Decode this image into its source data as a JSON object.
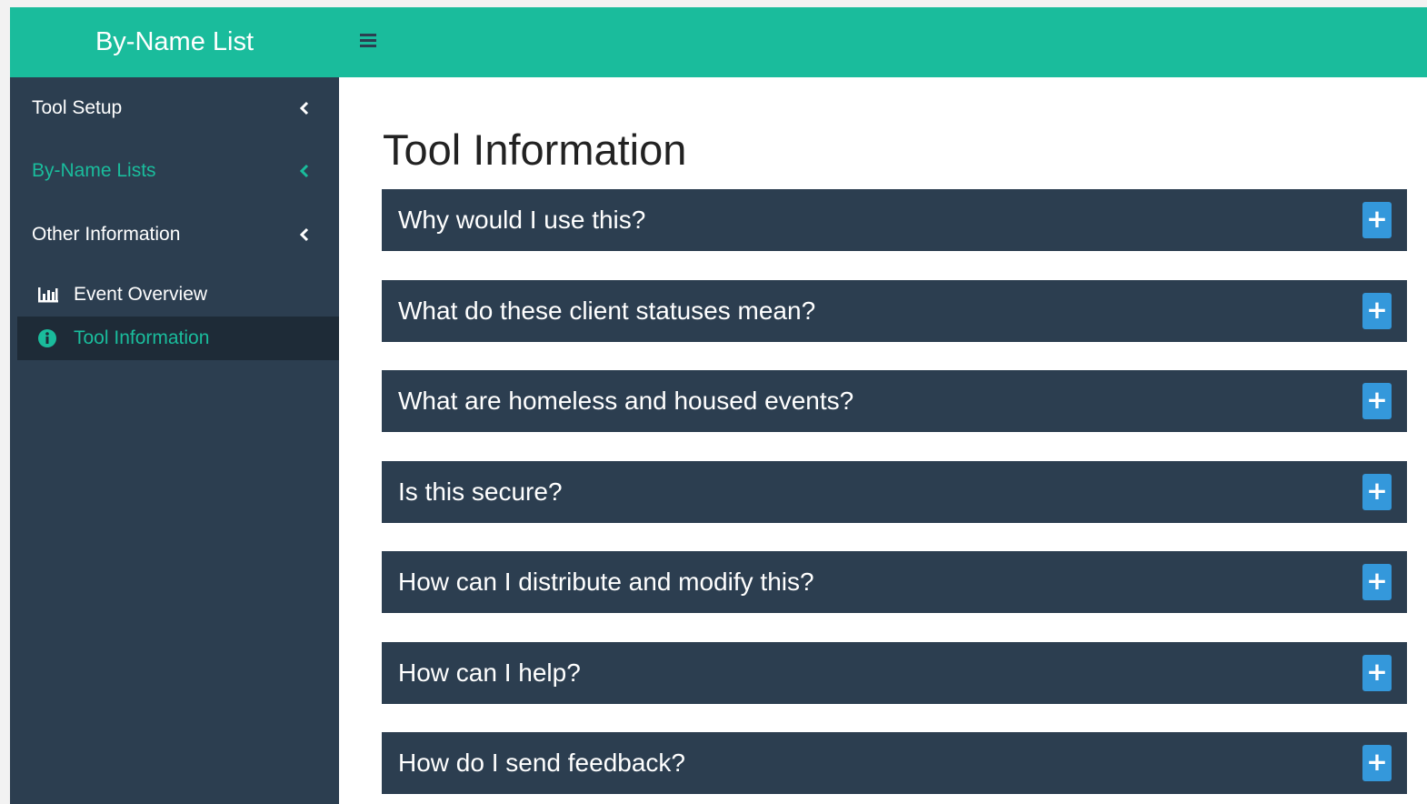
{
  "header": {
    "brand": "By-Name List"
  },
  "sidebar": {
    "items": [
      {
        "label": "Tool Setup"
      },
      {
        "label": "By-Name Lists"
      },
      {
        "label": "Other Information"
      }
    ],
    "subitems": [
      {
        "label": "Event Overview",
        "icon": "bar-chart-icon"
      },
      {
        "label": "Tool Information",
        "icon": "info-circle-icon"
      }
    ],
    "active_group": "By-Name Lists",
    "selected_item": "Tool Information"
  },
  "main": {
    "title": "Tool Information",
    "panels": [
      {
        "question": "Why would I use this?",
        "button": "+"
      },
      {
        "question": "What do these client statuses mean?",
        "button": "+"
      },
      {
        "question": "What are homeless and housed events?",
        "button": "+"
      },
      {
        "question": "Is this secure?",
        "button": "+"
      },
      {
        "question": "How can I distribute and modify this?",
        "button": "+"
      },
      {
        "question": "How can I help?",
        "button": "+"
      },
      {
        "question": "How do I send feedback?",
        "button": "+"
      }
    ]
  },
  "colors": {
    "header": "#1abc9c",
    "sidebar": "#2c3e50",
    "accent": "#1abc9c",
    "panel": "#2c3e50",
    "plus_button": "#3498db"
  }
}
